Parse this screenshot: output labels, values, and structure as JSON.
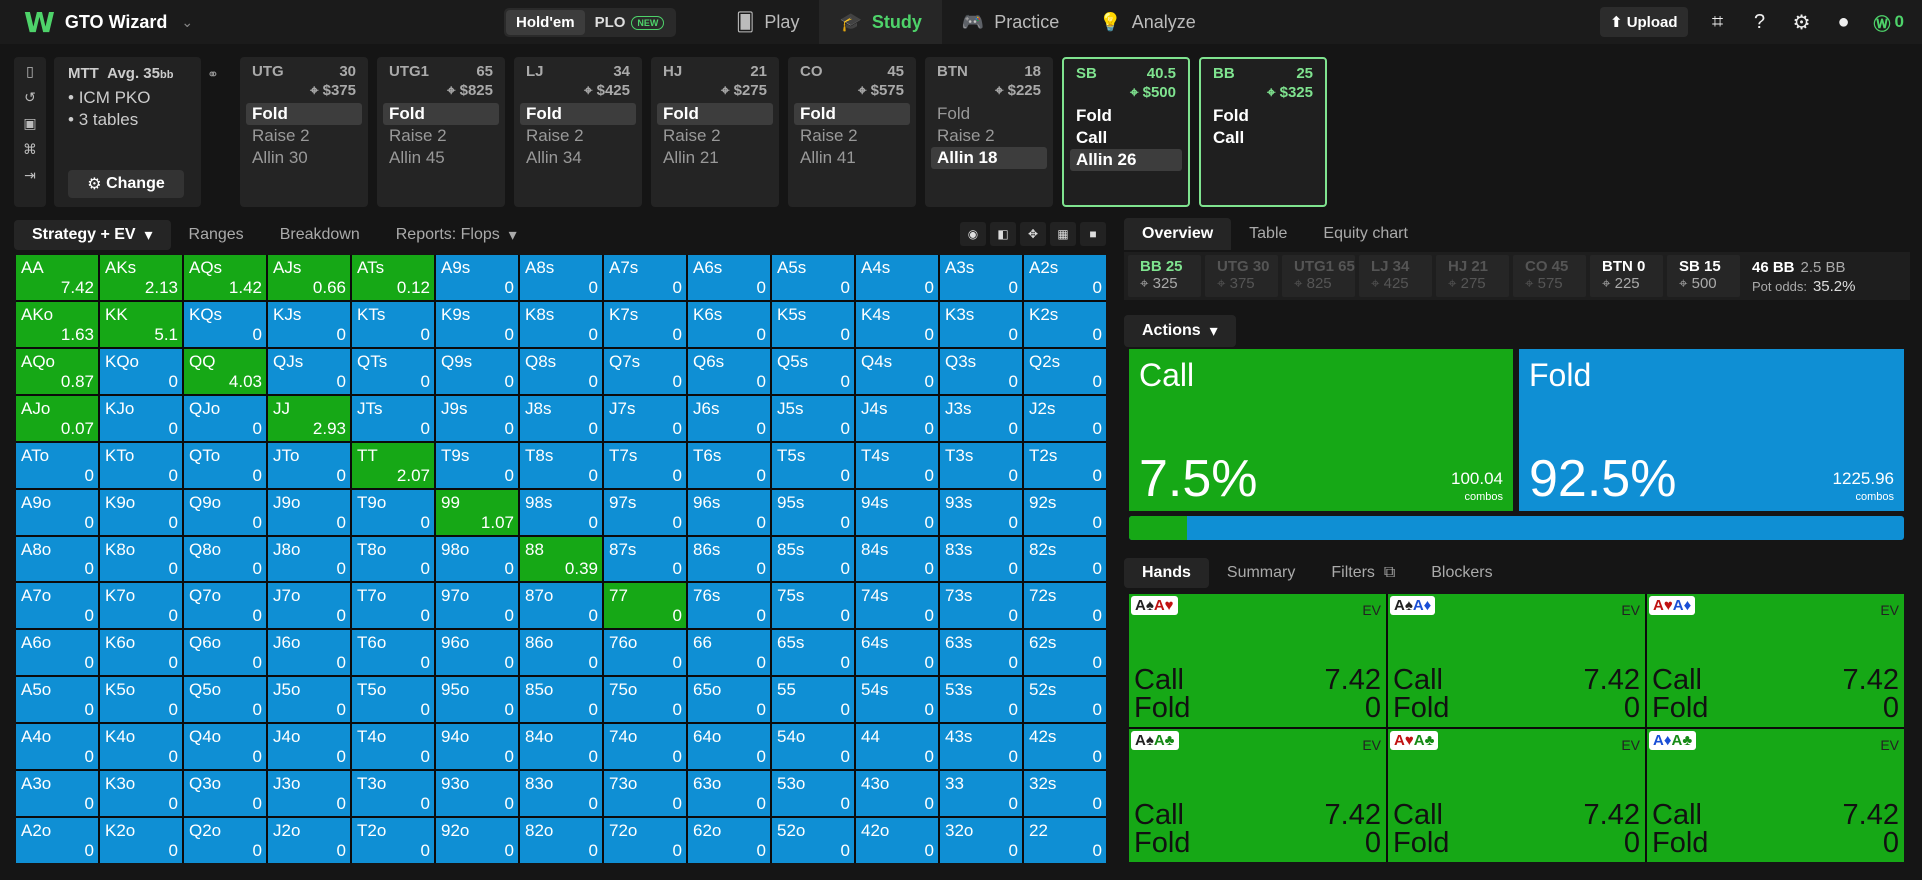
{
  "app": {
    "title": "GTO Wizard",
    "logo_mark": "W",
    "logo_chevron": "⌄"
  },
  "game_toggle": {
    "holdem": "Hold'em",
    "plo": "PLO",
    "new_badge": "NEW"
  },
  "nav": [
    {
      "key": "play",
      "label": "Play",
      "icon": "cards-icon"
    },
    {
      "key": "study",
      "label": "Study",
      "icon": "graduation-cap-icon",
      "active": true
    },
    {
      "key": "practice",
      "label": "Practice",
      "icon": "gamepad-icon"
    },
    {
      "key": "analyze",
      "label": "Analyze",
      "icon": "lightbulb-icon"
    }
  ],
  "topright": {
    "upload": "Upload",
    "credit": "0"
  },
  "tournament": {
    "format": "MTT",
    "avg": "Avg. 35",
    "avg_unit": "bb",
    "items": [
      "ICM PKO",
      "3 tables"
    ],
    "change": "Change"
  },
  "seats": [
    {
      "pos": "UTG",
      "bb": "30",
      "stack": "$375",
      "actions": [
        "Fold",
        "Raise 2",
        "Allin 30"
      ],
      "sel": 0
    },
    {
      "pos": "UTG1",
      "bb": "65",
      "stack": "$825",
      "actions": [
        "Fold",
        "Raise 2",
        "Allin 45"
      ],
      "sel": 0
    },
    {
      "pos": "LJ",
      "bb": "34",
      "stack": "$425",
      "actions": [
        "Fold",
        "Raise 2",
        "Allin 34"
      ],
      "sel": 0
    },
    {
      "pos": "HJ",
      "bb": "21",
      "stack": "$275",
      "actions": [
        "Fold",
        "Raise 2",
        "Allin 21"
      ],
      "sel": 0
    },
    {
      "pos": "CO",
      "bb": "45",
      "stack": "$575",
      "actions": [
        "Fold",
        "Raise 2",
        "Allin 41"
      ],
      "sel": 0
    },
    {
      "pos": "BTN",
      "bb": "18",
      "stack": "$225",
      "actions": [
        "Fold",
        "Raise 2",
        "Allin 18"
      ],
      "sel": 2
    },
    {
      "pos": "SB",
      "bb": "40.5",
      "stack": "$500",
      "actions": [
        "Fold",
        "Call",
        "Allin 26"
      ],
      "sel": 2,
      "highlight": true
    },
    {
      "pos": "BB",
      "bb": "25",
      "stack": "$325",
      "actions": [
        "Fold",
        "Call"
      ],
      "sel": -1,
      "highlight": true
    }
  ],
  "subtabs": {
    "strategy": "Strategy + EV",
    "ranges": "Ranges",
    "breakdown": "Breakdown",
    "reports": "Reports: Flops"
  },
  "grid": {
    "ranks": [
      "A",
      "K",
      "Q",
      "J",
      "T",
      "9",
      "8",
      "7",
      "6",
      "5",
      "4",
      "3",
      "2"
    ],
    "ev": {
      "AA": "7.42",
      "AKs": "2.13",
      "AQs": "1.42",
      "AJs": "0.66",
      "ATs": "0.12",
      "AKo": "1.63",
      "KK": "5.1",
      "AQo": "0.87",
      "QQ": "4.03",
      "AJo": "0.07",
      "JJ": "2.93",
      "TT": "2.07",
      "99": "1.07",
      "88": "0.39",
      "77": "0"
    },
    "green": [
      "AA",
      "AKs",
      "AQs",
      "AJs",
      "ATs",
      "AKo",
      "KK",
      "AQo",
      "QQ",
      "AJo",
      "JJ",
      "TT",
      "99",
      "88",
      "77"
    ],
    "default_ev": "0"
  },
  "overview": {
    "tabs": [
      "Overview",
      "Table",
      "Equity chart"
    ],
    "seatsummary": [
      {
        "a": "BB 25",
        "b": "325",
        "state": "cur"
      },
      {
        "a": "UTG 30",
        "b": "375",
        "state": "off"
      },
      {
        "a": "UTG1 65",
        "b": "825",
        "state": "off"
      },
      {
        "a": "LJ 34",
        "b": "425",
        "state": "off"
      },
      {
        "a": "HJ 21",
        "b": "275",
        "state": "off"
      },
      {
        "a": "CO 45",
        "b": "575",
        "state": "off"
      },
      {
        "a": "BTN 0",
        "b": "225",
        "state": "on"
      },
      {
        "a": "SB 15",
        "b": "500",
        "state": "on"
      }
    ],
    "pot": {
      "bb": "46 BB",
      "bb2": "2.5 BB",
      "odds_label": "Pot odds:",
      "odds": "35.2%"
    },
    "actions_label": "Actions",
    "call": {
      "name": "Call",
      "pct": "7.5%",
      "combos": "100.04",
      "combos_label": "combos"
    },
    "fold": {
      "name": "Fold",
      "pct": "92.5%",
      "combos": "1225.96",
      "combos_label": "combos"
    },
    "freq_call": 0.075
  },
  "hands_tabs": {
    "hands": "Hands",
    "summary": "Summary",
    "filters": "Filters",
    "blockers": "Blockers"
  },
  "hands": [
    {
      "c1": "A♠",
      "c1c": "blk",
      "c2": "A♥",
      "c2c": "red",
      "call": "7.42",
      "fold": "0"
    },
    {
      "c1": "A♠",
      "c1c": "blk",
      "c2": "A♦",
      "c2c": "blu",
      "call": "7.42",
      "fold": "0"
    },
    {
      "c1": "A♥",
      "c1c": "red",
      "c2": "A♦",
      "c2c": "blu",
      "call": "7.42",
      "fold": "0"
    },
    {
      "c1": "A♠",
      "c1c": "blk",
      "c2": "A♣",
      "c2c": "grn",
      "call": "7.42",
      "fold": "0"
    },
    {
      "c1": "A♥",
      "c1c": "red",
      "c2": "A♣",
      "c2c": "grn",
      "call": "7.42",
      "fold": "0"
    },
    {
      "c1": "A♦",
      "c1c": "blu",
      "c2": "A♣",
      "c2c": "grn",
      "call": "7.42",
      "fold": "0"
    }
  ],
  "hand_labels": {
    "ev": "EV",
    "call": "Call",
    "fold": "Fold"
  }
}
